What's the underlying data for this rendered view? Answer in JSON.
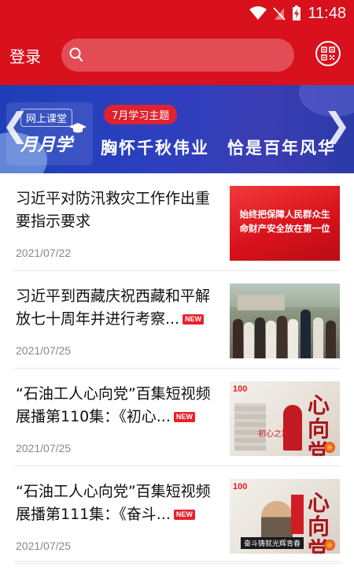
{
  "status_bar": {
    "time": "11:48"
  },
  "header": {
    "login_label": "登录",
    "search_placeholder": ""
  },
  "banner": {
    "tag": "网上课堂",
    "brand": "月月学",
    "theme": "7月学习主题",
    "slogan": "胸怀千秋伟业　恰是百年风华"
  },
  "news": [
    {
      "title": "习近平对防汛救灾工作作出重要指示要求",
      "date": "2021/07/22",
      "is_new": false,
      "new_label": "",
      "thumb_text": [
        "始终把保障人民群众生",
        "命财产安全放在第一位"
      ]
    },
    {
      "title": "习近平到西藏庆祝西藏和平解放七十周年并进行考察...",
      "date": "2021/07/25",
      "is_new": true,
      "new_label": "NEW"
    },
    {
      "title": "“石油工人心向党”百集短视频展播第110集：《初心...",
      "date": "2021/07/25",
      "is_new": true,
      "new_label": "NEW",
      "thumb_text": [
        "心向党",
        "初心之路"
      ]
    },
    {
      "title": "“石油工人心向党”百集短视频展播第111集：《奋斗...",
      "date": "2021/07/25",
      "is_new": true,
      "new_label": "NEW",
      "thumb_text": [
        "心向党",
        "奋斗铸就光辉青春"
      ]
    }
  ],
  "colors": {
    "primary": "#d8111c",
    "badge": "#e8202a",
    "banner": "#2c3fbf"
  }
}
